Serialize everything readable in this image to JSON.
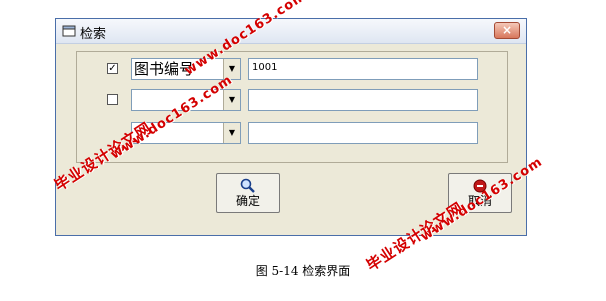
{
  "window": {
    "title": "检索",
    "close_glyph": "×"
  },
  "rows": [
    {
      "checked": true,
      "check_glyph": "✓",
      "field_name": "图书编号",
      "value": "1001"
    },
    {
      "checked": false,
      "check_glyph": "",
      "field_name": "",
      "value": ""
    },
    {
      "checked": false,
      "check_glyph": "",
      "field_name": "",
      "value": ""
    }
  ],
  "buttons": {
    "confirm": "确定",
    "cancel": "取消"
  },
  "caption": "图 5-14 检索界面",
  "watermarks": {
    "cn": "毕业设计论文网",
    "url": "www.doc163.com"
  }
}
